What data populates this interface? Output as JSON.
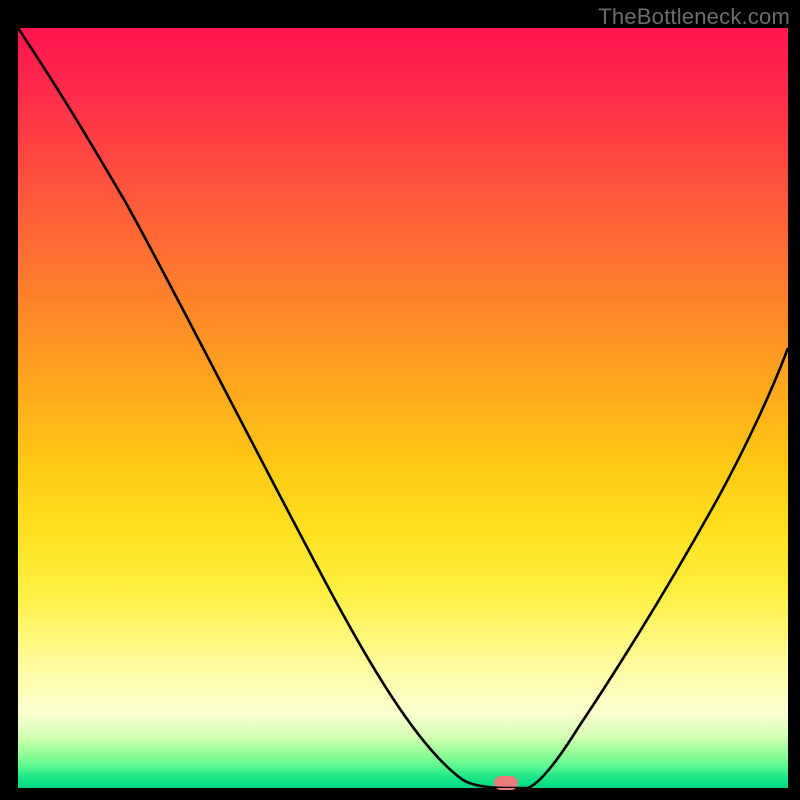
{
  "watermark": "TheBottleneck.com",
  "chart_data": {
    "type": "line",
    "title": "",
    "xlabel": "",
    "ylabel": "",
    "xlim": [
      0,
      100
    ],
    "ylim": [
      0,
      100
    ],
    "grid": false,
    "series": [
      {
        "name": "bottleneck-curve",
        "x": [
          0,
          10,
          20,
          30,
          40,
          50,
          55,
          58,
          60,
          62,
          64,
          66,
          70,
          80,
          90,
          100
        ],
        "values": [
          100,
          87,
          73,
          58,
          43,
          27,
          15,
          6,
          1,
          0,
          0,
          1,
          8,
          28,
          48,
          68
        ]
      }
    ],
    "marker": {
      "x": 63,
      "y": 0
    },
    "gradient_stops": [
      {
        "pct": 0,
        "color": "#ff1450"
      },
      {
        "pct": 50,
        "color": "#ffca14"
      },
      {
        "pct": 90,
        "color": "#fcffce"
      },
      {
        "pct": 100,
        "color": "#00d882"
      }
    ]
  }
}
